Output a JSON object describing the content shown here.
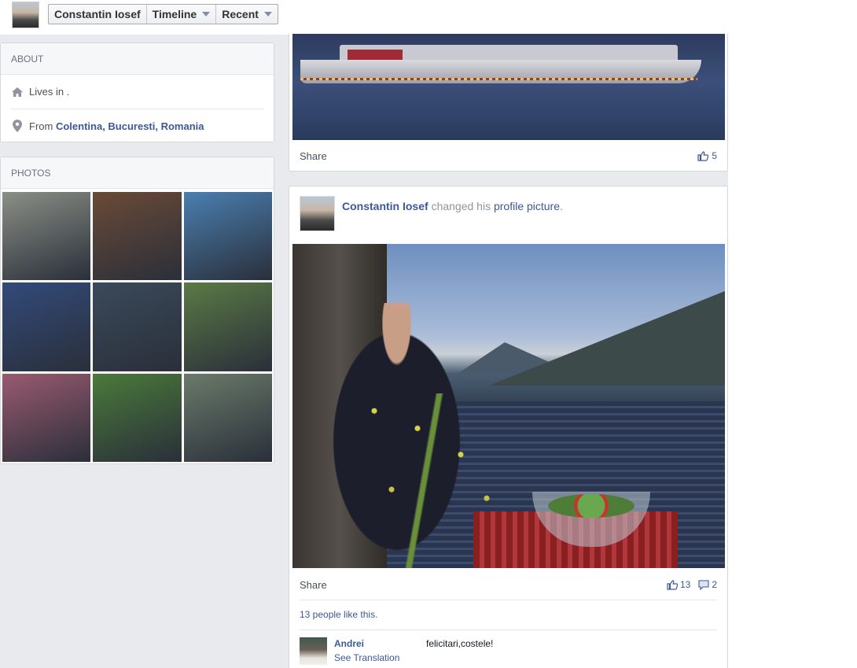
{
  "topbar": {
    "profile_name": "Constantin Iosef",
    "timeline_label": "Timeline",
    "recent_label": "Recent"
  },
  "about": {
    "header": "ABOUT",
    "lives_in_prefix": "Lives in",
    "lives_in_value": ".",
    "from_prefix": "From",
    "from_value": "Colentina, Bucuresti, Romania"
  },
  "photos": {
    "header": "PHOTOS",
    "items": [
      {
        "color": "#8a8f86"
      },
      {
        "color": "#6a4a36"
      },
      {
        "color": "#4a7fb0"
      },
      {
        "color": "#324a7a"
      },
      {
        "color": "#3a4a5a"
      },
      {
        "color": "#5a7a45"
      },
      {
        "color": "#9a5a70"
      },
      {
        "color": "#4a7a3a"
      },
      {
        "color": "#6a7a6a"
      }
    ]
  },
  "post1": {
    "share_label": "Share",
    "like_count": "5"
  },
  "post2": {
    "author": "Constantin Iosef",
    "action_text": "changed his",
    "link_text": "profile picture",
    "period": ".",
    "share_label": "Share",
    "like_count": "13",
    "comment_count": "2",
    "like_summary": "13 people like this.",
    "comment": {
      "author": "Andrei",
      "text": "felicitari,costele!",
      "translation_link": "See Translation"
    }
  },
  "colors": {
    "link": "#3b5998",
    "background": "#e9eaed"
  }
}
